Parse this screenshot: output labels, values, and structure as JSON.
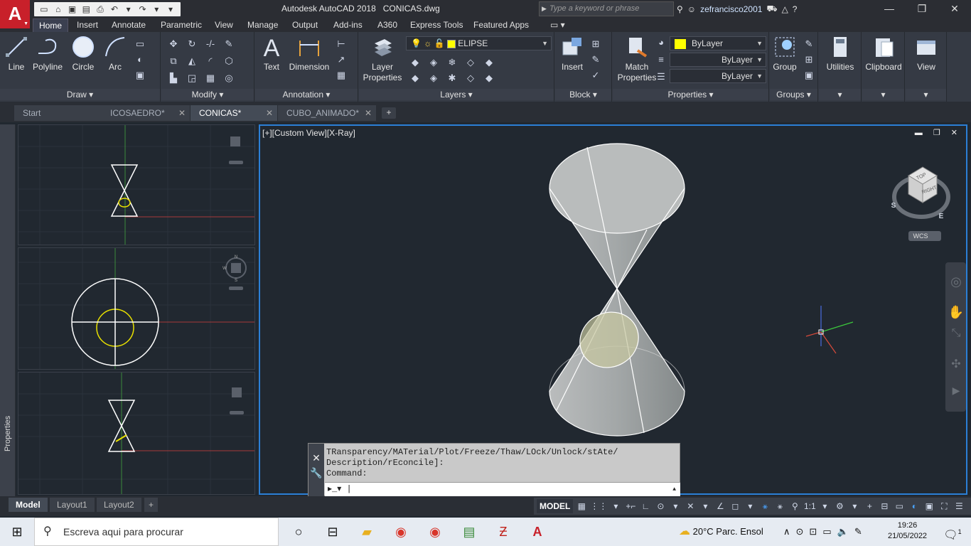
{
  "app": {
    "logo": "A",
    "title": "Autodesk AutoCAD 2018",
    "file": "CONICAS.dwg",
    "search_placeholder": "Type a keyword or phrase",
    "user": "zefrancisco2001"
  },
  "ribbon_tabs": [
    "Home",
    "Insert",
    "Annotate",
    "Parametric",
    "View",
    "Manage",
    "Output",
    "Add-ins",
    "A360",
    "Express Tools",
    "Featured Apps"
  ],
  "draw": {
    "title": "Draw",
    "line": "Line",
    "polyline": "Polyline",
    "circle": "Circle",
    "arc": "Arc"
  },
  "modify": {
    "title": "Modify"
  },
  "annotation": {
    "title": "Annotation",
    "text": "Text",
    "dimension": "Dimension"
  },
  "layers": {
    "title": "Layers",
    "layer_properties": "Layer Properties",
    "current_layer": "ELIPSE",
    "layer_color": "#ffff00"
  },
  "block": {
    "title": "Block",
    "insert": "Insert"
  },
  "properties": {
    "title": "Properties",
    "match": "Match Properties",
    "color": "ByLayer",
    "linetype": "ByLayer",
    "lineweight": "ByLayer"
  },
  "groups": {
    "title": "Groups",
    "group": "Group"
  },
  "utilities": "Utilities",
  "clipboard": "Clipboard",
  "view": "View",
  "file_tabs": [
    "Start",
    "ICOSAEDRO*",
    "CONICAS*",
    "CUBO_ANIMADO*"
  ],
  "properties_palette": "Properties",
  "viewport_label": "[+][Custom View][X-Ray]",
  "viewcube": {
    "top": "TOP",
    "right": "RIGHT",
    "s": "S",
    "e": "E",
    "wcs": "WCS"
  },
  "small_compass": {
    "n": "N",
    "w": "W",
    "s": "S"
  },
  "command": {
    "history": "TRansparency/MATerial/Plot/Freeze/Thaw/LOck/Unlock/stAte/\nDescription/rEconcile]:\nCommand:",
    "input": ""
  },
  "layout_tabs": [
    "Model",
    "Layout1",
    "Layout2"
  ],
  "status": {
    "model": "MODEL",
    "scale": "1:1"
  },
  "taskbar": {
    "search": "Escreva aqui para procurar",
    "weather": "20°C  Parc. Ensol",
    "time": "19:26",
    "date": "21/05/2022",
    "notifications": "1"
  }
}
